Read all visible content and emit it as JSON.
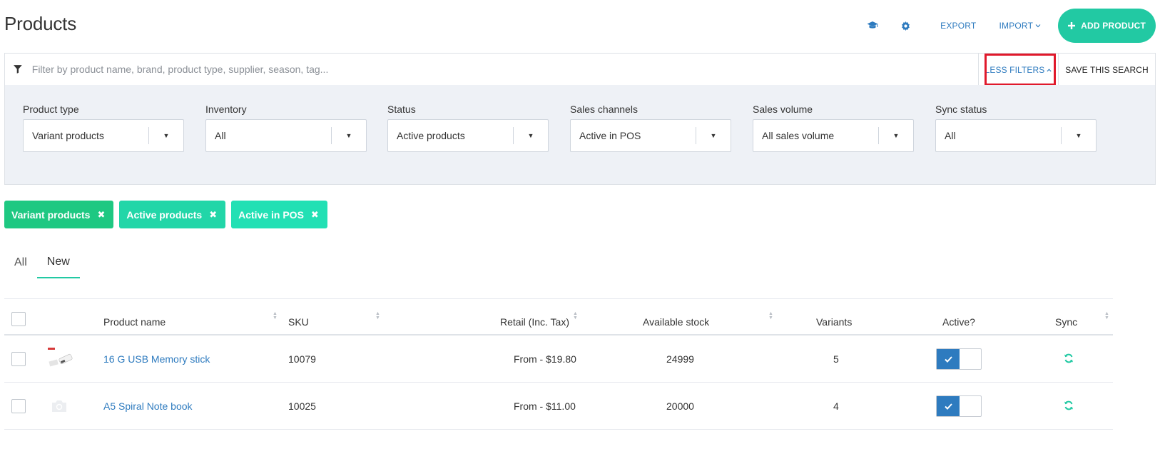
{
  "header": {
    "title": "Products",
    "export_label": "EXPORT",
    "import_label": "IMPORT",
    "add_label": "ADD PRODUCT"
  },
  "filter_bar": {
    "placeholder": "Filter by product name, brand, product type, supplier, season, tag...",
    "less_filters_label": "LESS FILTERS",
    "save_search_label": "SAVE THIS SEARCH"
  },
  "filters": [
    {
      "label": "Product type",
      "value": "Variant products"
    },
    {
      "label": "Inventory",
      "value": "All"
    },
    {
      "label": "Status",
      "value": "Active products"
    },
    {
      "label": "Sales channels",
      "value": "Active in POS"
    },
    {
      "label": "Sales volume",
      "value": "All sales volume"
    },
    {
      "label": "Sync status",
      "value": "All"
    }
  ],
  "chips": [
    {
      "label": "Variant products",
      "color": "#1ec882"
    },
    {
      "label": "Active products",
      "color": "#22d6a8"
    },
    {
      "label": "Active in POS",
      "color": "#22e0b4"
    }
  ],
  "tabs": [
    {
      "label": "All"
    },
    {
      "label": "New"
    }
  ],
  "table": {
    "headers": {
      "name": "Product name",
      "sku": "SKU",
      "retail": "Retail (Inc. Tax)",
      "stock": "Available stock",
      "variants": "Variants",
      "active": "Active?",
      "sync": "Sync"
    },
    "rows": [
      {
        "name": "16 G USB Memory stick",
        "sku": "10079",
        "retail": "From - $19.80",
        "stock": "24999",
        "variants": "5"
      },
      {
        "name": "A5 Spiral Note book",
        "sku": "10025",
        "retail": "From - $11.00",
        "stock": "20000",
        "variants": "4"
      }
    ]
  },
  "colors": {
    "accent": "#22c9a3",
    "link": "#2e7bbf",
    "highlight": "#e0192b"
  }
}
